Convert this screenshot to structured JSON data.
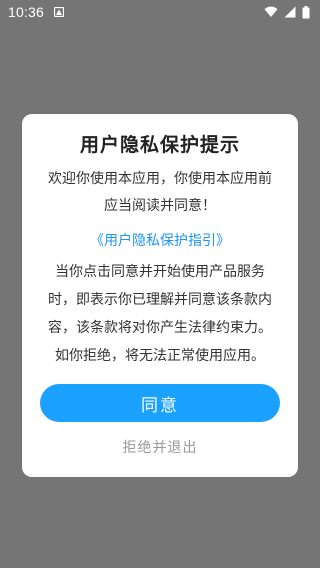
{
  "status_bar": {
    "time": "10:36",
    "icons": [
      "notification-icon",
      "wifi-icon",
      "cellular-signal-icon",
      "battery-icon"
    ]
  },
  "dialog": {
    "title": "用户隐私保护提示",
    "intro_line1": "欢迎你使用本应用，你使用本应用前",
    "intro_line2": "应当阅读并同意！",
    "policy_link": "《用户隐私保护指引》",
    "body_line1": "当你点击同意并开始使用产品服务",
    "body_line2": "时，即表示你已理解并同意该条款内",
    "body_line3": "容，该条款将对你产生法律约束力。",
    "body_line4": "如你拒绝，将无法正常使用应用。",
    "agree_label": "同意",
    "decline_label": "拒绝并退出"
  },
  "colors": {
    "overlay": "#757575",
    "accent": "#1ba1ff",
    "link": "#2196f3",
    "decline_text": "#9a9a9a"
  }
}
